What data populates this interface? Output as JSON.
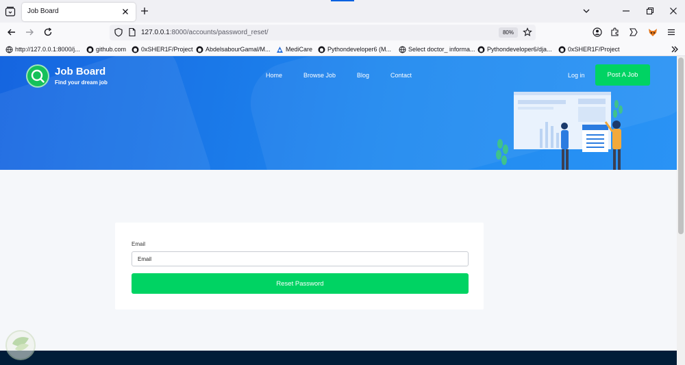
{
  "browser": {
    "tab_title": "Job Board",
    "url_host": "127.0.0.1",
    "url_rest": ":8000/accounts/password_reset/",
    "zoom": "80%",
    "bookmarks": [
      {
        "label": "http://127.0.0.1:8000/j...",
        "icon": "globe-icon"
      },
      {
        "label": "github.com",
        "icon": "github-icon"
      },
      {
        "label": "0xSHER1F/Project",
        "icon": "github-icon"
      },
      {
        "label": "AbdelsabourGamal/M...",
        "icon": "github-icon"
      },
      {
        "label": "MediCare",
        "icon": "medicare-icon"
      },
      {
        "label": "Pythondeveloper6 (M...",
        "icon": "github-icon"
      },
      {
        "label": "Select doctor_ informa...",
        "icon": "globe-icon"
      },
      {
        "label": "Pythondeveloper6/dja...",
        "icon": "github-icon"
      },
      {
        "label": "0xSHER1F/Project",
        "icon": "github-icon"
      }
    ]
  },
  "site": {
    "logo_title": "Job Board",
    "logo_subtitle": "Find your dream job",
    "nav": [
      "Home",
      "Browse Job",
      "Blog",
      "Contact"
    ],
    "login": "Log in",
    "post_job": "Post A Job",
    "accent_color": "#00d363",
    "hero_color": "#1f8af0"
  },
  "form": {
    "email_label": "Email",
    "email_placeholder": "Email",
    "submit": "Reset Password"
  }
}
